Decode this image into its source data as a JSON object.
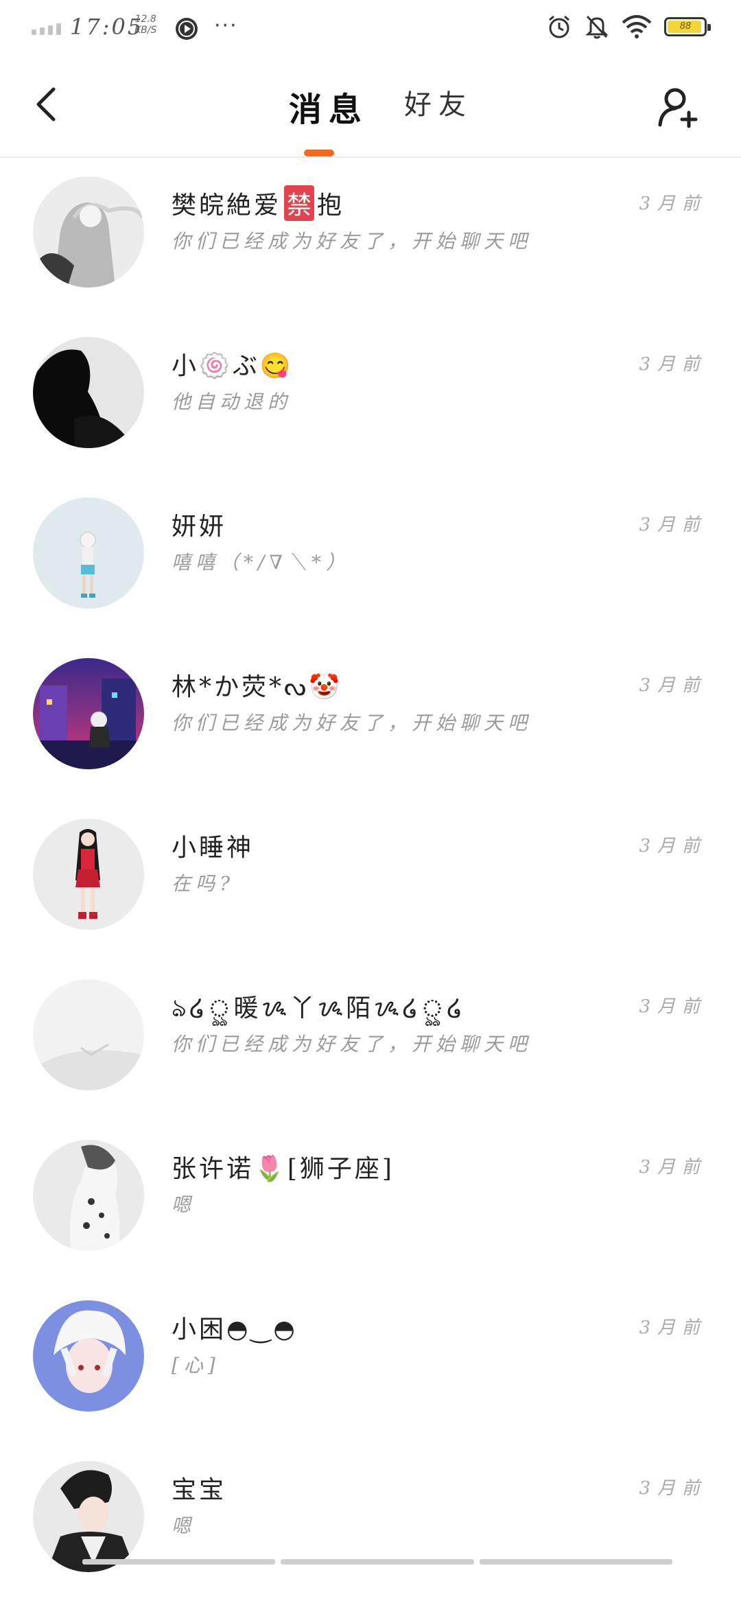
{
  "status_bar": {
    "time": "17:05",
    "speed_value": "12.8",
    "speed_unit": "KB/S",
    "more": "···",
    "battery_level": "88"
  },
  "header": {
    "tabs": [
      {
        "label": "消息",
        "active": true
      },
      {
        "label": "好友",
        "active": false
      }
    ]
  },
  "colors": {
    "accent": "#f26b1d",
    "badge": "#e0454f",
    "battery": "#f4d437"
  },
  "chats": [
    {
      "name_before": "樊皖絶爱",
      "badge": "禁",
      "name_after": "抱",
      "preview": "你们已经成为好友了，开始聊天吧",
      "time": "3月前"
    },
    {
      "name": "小🍥ぶ😋",
      "preview": "他自动退的",
      "time": "3月前"
    },
    {
      "name": "妍妍",
      "preview": "嘻嘻（*/∇＼*）",
      "time": "3月前"
    },
    {
      "name": "林*か荧*ᔓ🤡",
      "preview": "你们已经成为好友了，开始聊天吧",
      "time": "3月前"
    },
    {
      "name": "小睡神",
      "preview": "在吗?",
      "time": "3月前"
    },
    {
      "name": "ঌ໒ৣ暖ᝰ丫ᝰ陌ᝰ໒ৣ໒",
      "preview": "你们已经成为好友了，开始聊天吧",
      "time": "3月前"
    },
    {
      "name": "张许诺🌷[狮子座]",
      "preview": "嗯",
      "time": "3月前"
    },
    {
      "name": "小困◓‿◓",
      "preview": "[心]",
      "time": "3月前"
    },
    {
      "name": "宝宝",
      "preview": "嗯",
      "time": "3月前"
    }
  ]
}
